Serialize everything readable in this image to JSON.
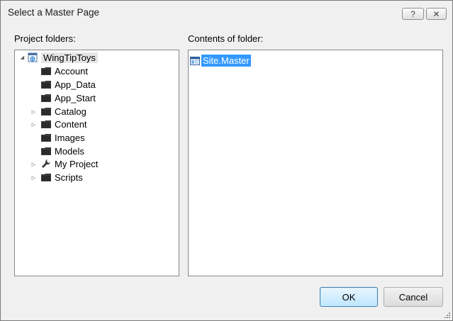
{
  "window": {
    "title": "Select a Master Page",
    "help_glyph": "?",
    "close_glyph": "✕"
  },
  "left": {
    "label": "Project folders:",
    "tree": [
      {
        "label": "WingTipToys",
        "icon": "project-icon",
        "expander": "expanded",
        "level": 0
      },
      {
        "label": "Account",
        "icon": "folder-icon",
        "expander": "none",
        "level": 1
      },
      {
        "label": "App_Data",
        "icon": "folder-icon",
        "expander": "none",
        "level": 1
      },
      {
        "label": "App_Start",
        "icon": "folder-icon",
        "expander": "none",
        "level": 1
      },
      {
        "label": "Catalog",
        "icon": "folder-icon",
        "expander": "collapsed",
        "level": 1
      },
      {
        "label": "Content",
        "icon": "folder-icon",
        "expander": "collapsed",
        "level": 1
      },
      {
        "label": "Images",
        "icon": "folder-icon",
        "expander": "none",
        "level": 1
      },
      {
        "label": "Models",
        "icon": "folder-icon",
        "expander": "none",
        "level": 1
      },
      {
        "label": "My Project",
        "icon": "wrench-icon",
        "expander": "collapsed",
        "level": 1
      },
      {
        "label": "Scripts",
        "icon": "folder-icon",
        "expander": "collapsed",
        "level": 1
      }
    ]
  },
  "right": {
    "label": "Contents of folder:",
    "files": [
      {
        "label": "Site.Master",
        "icon": "master-page-icon",
        "selected": true
      }
    ]
  },
  "buttons": {
    "ok": "OK",
    "cancel": "Cancel"
  },
  "colors": {
    "selection": "#3399ff",
    "dialog_bg": "#f0f0f0",
    "border": "#828790"
  }
}
